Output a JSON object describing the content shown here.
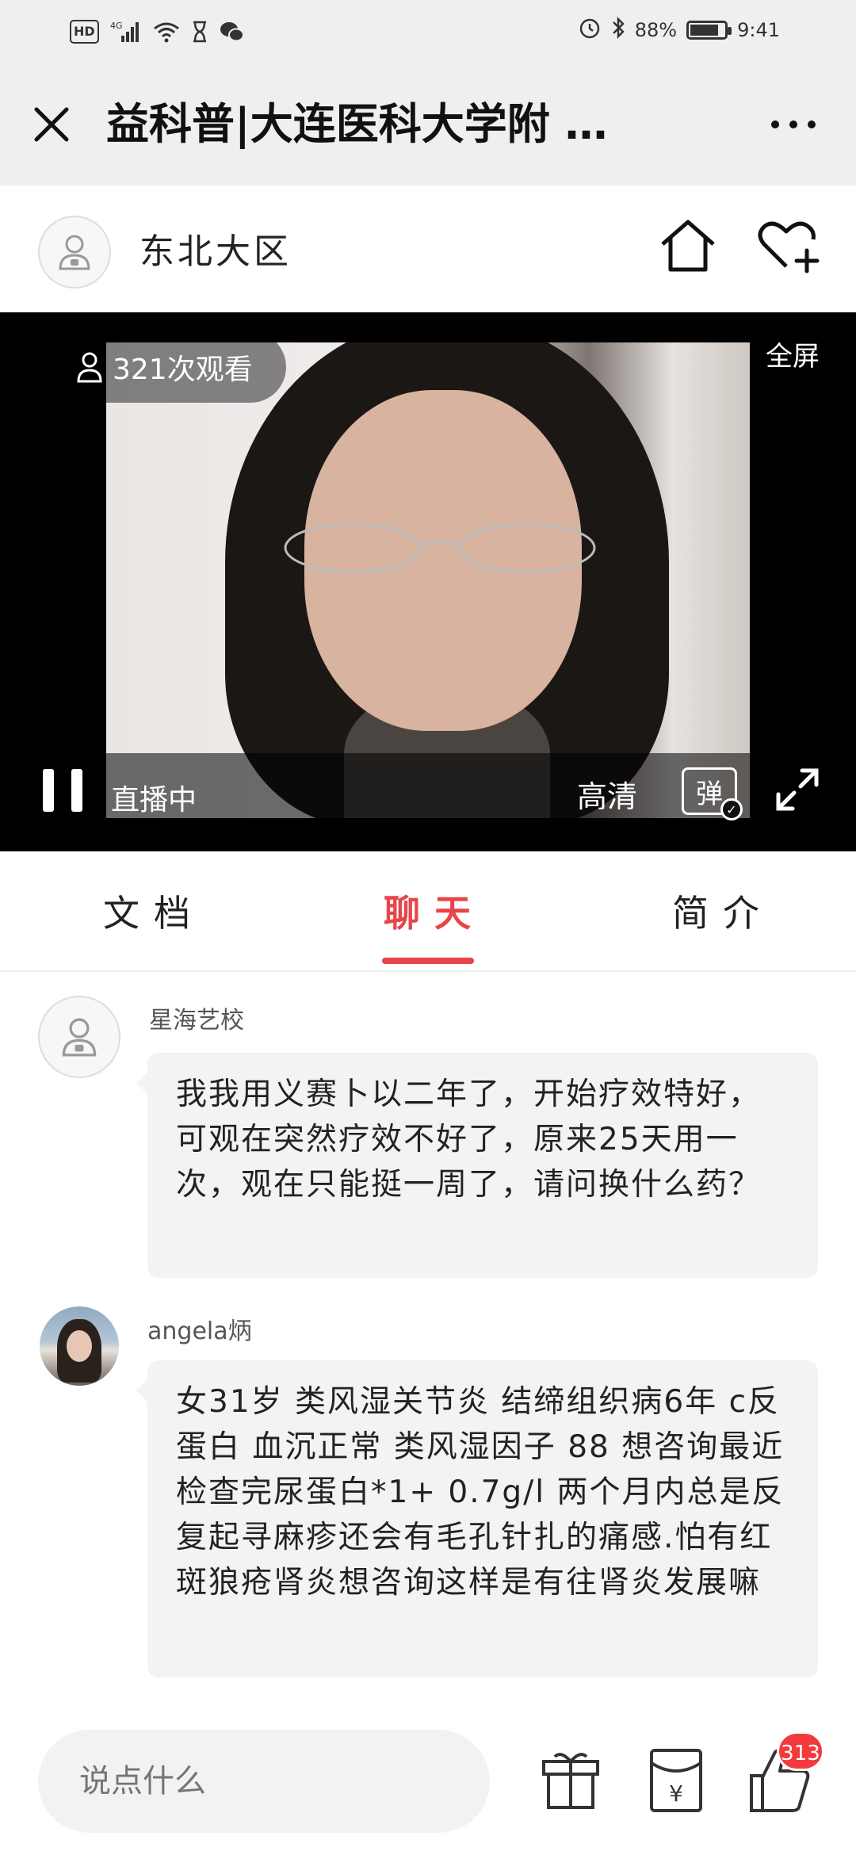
{
  "status_bar": {
    "hd": "HD",
    "network": "4G",
    "battery": "88%",
    "time": "9:41",
    "battery_level": 0.88
  },
  "title_bar": {
    "title": "益科普|大连医科大学附 …"
  },
  "channel": {
    "name": "东北大区"
  },
  "video": {
    "viewer_count": "321次观看",
    "fullscreen_label": "全屏",
    "live_status": "直播中",
    "quality": "高清",
    "danmu": "弹"
  },
  "tabs": [
    {
      "label": "文档",
      "active": false
    },
    {
      "label": "聊天",
      "active": true
    },
    {
      "label": "简介",
      "active": false
    }
  ],
  "messages": [
    {
      "name": "星海艺校",
      "text": "我我用义赛卜以二年了，开始疗效特好，可观在突然疗效不好了，原来25天用一次，观在只能挺一周了，请问换什么药？"
    },
    {
      "name": "angela炳",
      "text": "女31岁 类风湿关节炎 结缔组织病6年 c反蛋白 血沉正常 类风湿因子 88 想咨询最近检查完尿蛋白*1+ 0.7g/l 两个月内总是反复起寻麻疹还会有毛孔针扎的痛感.怕有红斑狼疮肾炎想咨询这样是有往肾炎发展嘛"
    }
  ],
  "bottom_bar": {
    "input_placeholder": "说点什么",
    "like_count": "313"
  },
  "colors": {
    "accent": "#e8454a",
    "badge": "#f23a3c"
  }
}
